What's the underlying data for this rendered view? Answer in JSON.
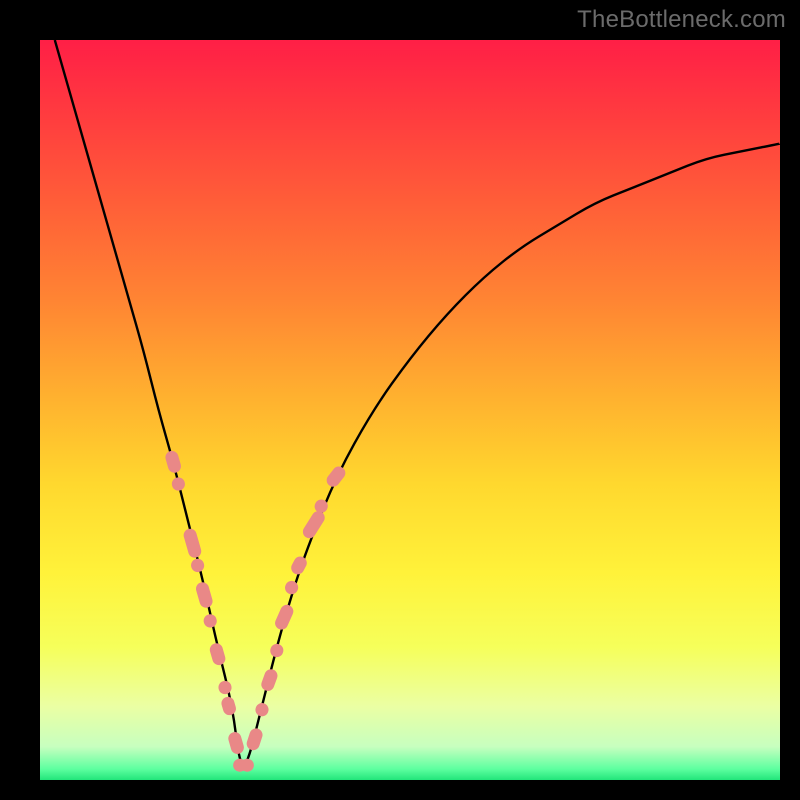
{
  "watermark": {
    "text": "TheBottleneck.com"
  },
  "gradient": {
    "stops": [
      {
        "offset": 0.0,
        "color": "#ff1f46"
      },
      {
        "offset": 0.1,
        "color": "#ff3b3f"
      },
      {
        "offset": 0.22,
        "color": "#ff5e38"
      },
      {
        "offset": 0.35,
        "color": "#ff8433"
      },
      {
        "offset": 0.48,
        "color": "#ffb02f"
      },
      {
        "offset": 0.6,
        "color": "#ffd82e"
      },
      {
        "offset": 0.72,
        "color": "#fff23a"
      },
      {
        "offset": 0.82,
        "color": "#f6ff5a"
      },
      {
        "offset": 0.9,
        "color": "#ebffa3"
      },
      {
        "offset": 0.955,
        "color": "#c7ffbf"
      },
      {
        "offset": 0.985,
        "color": "#5effa0"
      },
      {
        "offset": 1.0,
        "color": "#22e57a"
      }
    ]
  },
  "chart_data": {
    "type": "line",
    "title": "",
    "xlabel": "",
    "ylabel": "",
    "xlim": [
      0,
      100
    ],
    "ylim": [
      0,
      100
    ],
    "series": [
      {
        "name": "bottleneck-curve",
        "x": [
          2,
          4,
          6,
          8,
          10,
          12,
          14,
          16,
          18,
          20,
          22,
          24,
          26,
          27,
          28,
          30,
          32,
          34,
          36,
          40,
          45,
          50,
          55,
          60,
          65,
          70,
          75,
          80,
          85,
          90,
          95,
          100
        ],
        "values": [
          100,
          93,
          86,
          79,
          72,
          65,
          58,
          50,
          43,
          35,
          27,
          18,
          10,
          2,
          2,
          10,
          18,
          25,
          31,
          41,
          50,
          57,
          63,
          68,
          72,
          75,
          78,
          80,
          82,
          84,
          85,
          86
        ]
      }
    ],
    "markers": {
      "name": "highlighted-segments",
      "color": "#e98887",
      "points": [
        {
          "x": 18.0,
          "y": 43.0,
          "len": 3.0,
          "angle": -74
        },
        {
          "x": 18.7,
          "y": 40.0,
          "len": 1.8,
          "angle": -74
        },
        {
          "x": 20.6,
          "y": 32.0,
          "len": 4.0,
          "angle": -74
        },
        {
          "x": 21.3,
          "y": 29.0,
          "len": 1.8,
          "angle": -74
        },
        {
          "x": 22.2,
          "y": 25.0,
          "len": 3.5,
          "angle": -74
        },
        {
          "x": 23.0,
          "y": 21.5,
          "len": 1.8,
          "angle": -74
        },
        {
          "x": 24.0,
          "y": 17.0,
          "len": 3.0,
          "angle": -74
        },
        {
          "x": 25.0,
          "y": 12.5,
          "len": 1.8,
          "angle": -74
        },
        {
          "x": 25.5,
          "y": 10.0,
          "len": 2.5,
          "angle": -74
        },
        {
          "x": 26.5,
          "y": 5.0,
          "len": 3.0,
          "angle": -74
        },
        {
          "x": 27.0,
          "y": 2.0,
          "len": 1.8,
          "angle": 0
        },
        {
          "x": 28.0,
          "y": 2.0,
          "len": 1.8,
          "angle": 0
        },
        {
          "x": 29.0,
          "y": 5.5,
          "len": 3.0,
          "angle": 72
        },
        {
          "x": 30.0,
          "y": 9.5,
          "len": 1.8,
          "angle": 72
        },
        {
          "x": 31.0,
          "y": 13.5,
          "len": 3.0,
          "angle": 70
        },
        {
          "x": 32.0,
          "y": 17.5,
          "len": 1.8,
          "angle": 68
        },
        {
          "x": 33.0,
          "y": 22.0,
          "len": 3.5,
          "angle": 66
        },
        {
          "x": 34.0,
          "y": 26.0,
          "len": 1.8,
          "angle": 64
        },
        {
          "x": 35.0,
          "y": 29.0,
          "len": 2.5,
          "angle": 62
        },
        {
          "x": 37.0,
          "y": 34.5,
          "len": 4.0,
          "angle": 58
        },
        {
          "x": 38.0,
          "y": 37.0,
          "len": 1.8,
          "angle": 56
        },
        {
          "x": 40.0,
          "y": 41.0,
          "len": 3.0,
          "angle": 52
        }
      ]
    }
  }
}
